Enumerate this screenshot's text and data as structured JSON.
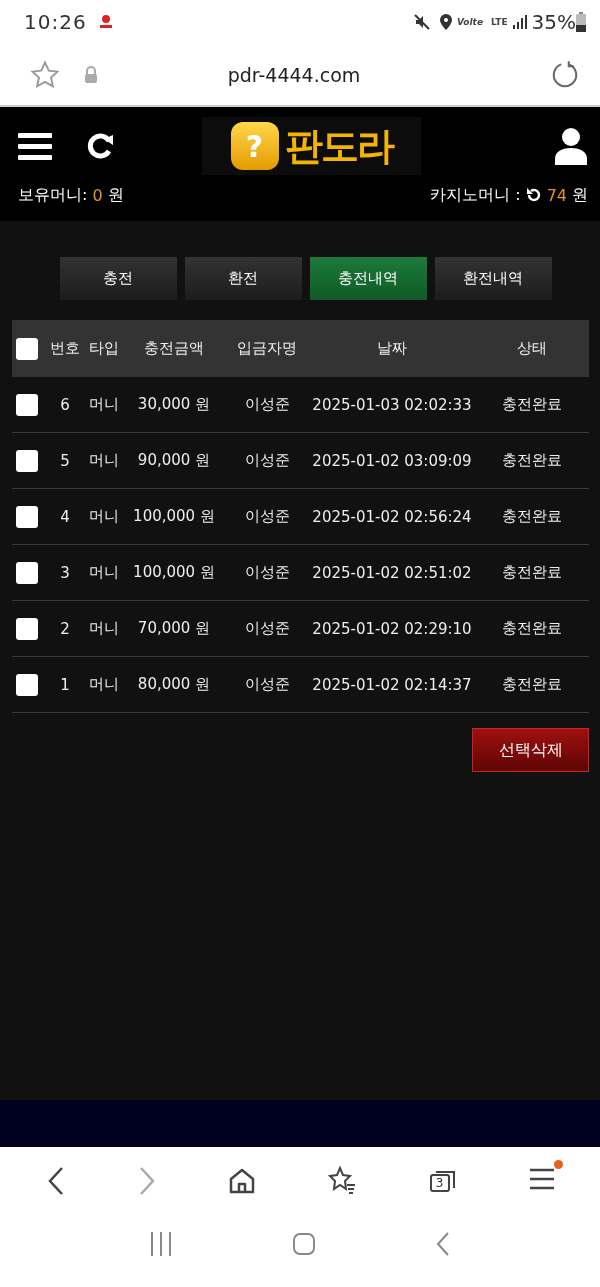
{
  "status_bar": {
    "time": "10:26",
    "volte": "Volte",
    "network": "LTE",
    "battery": "35%"
  },
  "address_bar": {
    "url": "pdr-4444.com"
  },
  "header": {
    "logo": "판도라",
    "logo_badge": "?",
    "money_label": "보유머니:",
    "money_value": "0",
    "money_unit": "원",
    "casino_label": "카지노머니 :",
    "casino_value": "74",
    "casino_unit": "원"
  },
  "tabs": [
    {
      "label": "충전",
      "selected": false
    },
    {
      "label": "환전",
      "selected": false
    },
    {
      "label": "충전내역",
      "selected": true
    },
    {
      "label": "환전내역",
      "selected": false
    }
  ],
  "table": {
    "select_all_checked": false,
    "columns": [
      "번호",
      "타입",
      "충전금액",
      "입금자명",
      "날짜",
      "상태"
    ],
    "rows": [
      {
        "checked": false,
        "cells": [
          "6",
          "머니",
          "30,000 원",
          "이성준",
          "2025-01-03 02:02:33",
          "충전완료"
        ]
      },
      {
        "checked": false,
        "cells": [
          "5",
          "머니",
          "90,000 원",
          "이성준",
          "2025-01-02 03:09:09",
          "충전완료"
        ]
      },
      {
        "checked": false,
        "cells": [
          "4",
          "머니",
          "100,000 원",
          "이성준",
          "2025-01-02 02:56:24",
          "충전완료"
        ]
      },
      {
        "checked": false,
        "cells": [
          "3",
          "머니",
          "100,000 원",
          "이성준",
          "2025-01-02 02:51:02",
          "충전완료"
        ]
      },
      {
        "checked": false,
        "cells": [
          "2",
          "머니",
          "70,000 원",
          "이성준",
          "2025-01-02 02:29:10",
          "충전완료"
        ]
      },
      {
        "checked": false,
        "cells": [
          "1",
          "머니",
          "80,000 원",
          "이성준",
          "2025-01-02 02:14:37",
          "충전완료"
        ]
      }
    ]
  },
  "delete_button": "선택삭제",
  "browser_nav": {
    "tab_count": "3",
    "menu_badge": true
  }
}
